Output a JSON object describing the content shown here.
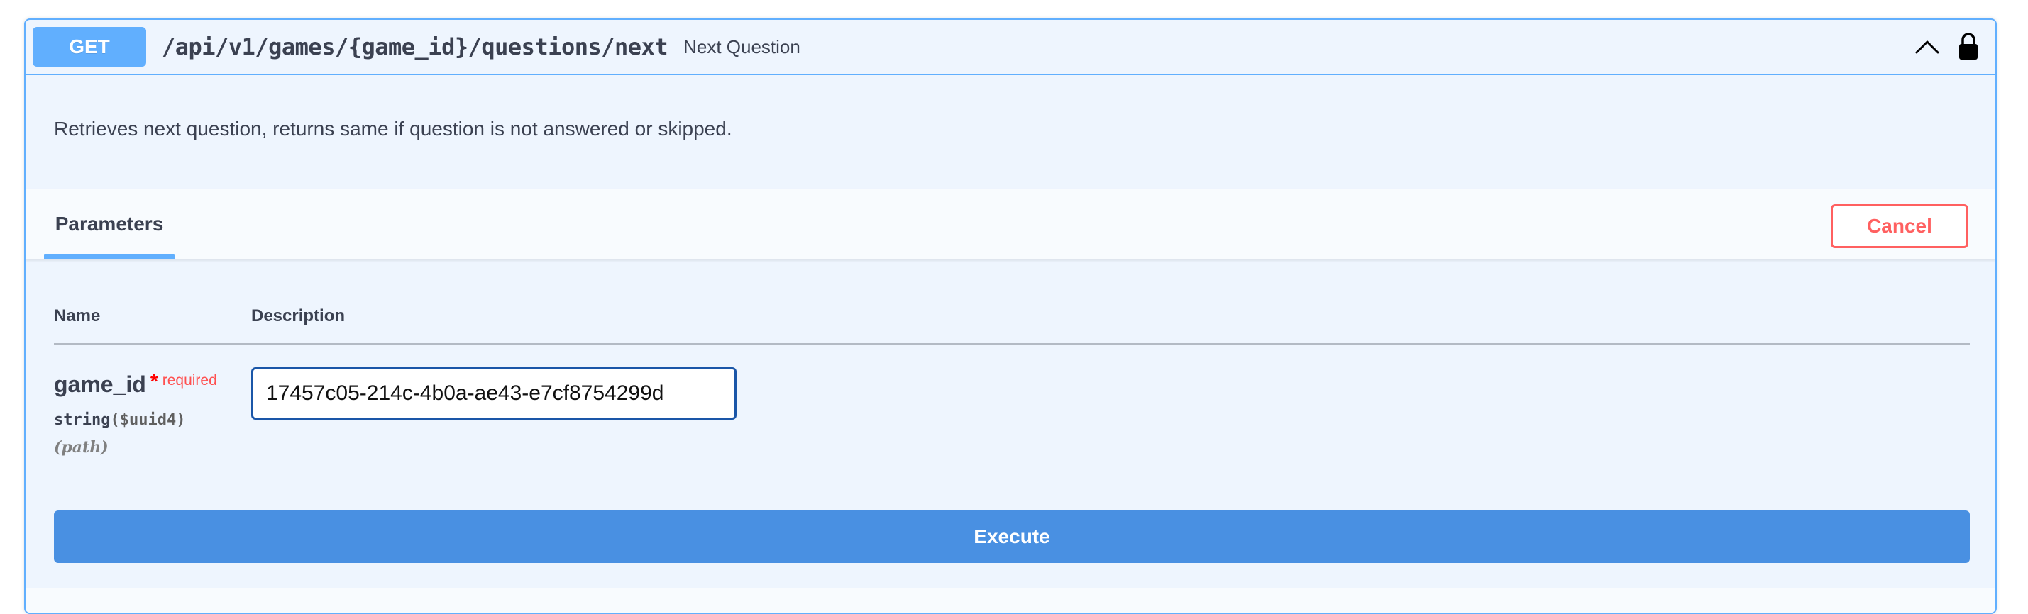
{
  "operation": {
    "method": "GET",
    "path": "/api/v1/games/{game_id}/questions/next",
    "summary": "Next Question",
    "description": "Retrieves next question, returns same if question is not answered or skipped."
  },
  "icons": {
    "collapse": "chevron-up-icon",
    "auth": "lock-icon"
  },
  "tabs": {
    "parameters_label": "Parameters",
    "cancel_label": "Cancel"
  },
  "table": {
    "columns": [
      "Name",
      "Description"
    ]
  },
  "parameter": {
    "name": "game_id",
    "required_marker": "*",
    "required_label": "required",
    "type": "string",
    "format": "($uuid4)",
    "location": "(path)",
    "value": "17457c05-214c-4b0a-ae43-e7cf8754299d"
  },
  "actions": {
    "execute_label": "Execute"
  },
  "colors": {
    "get_accent": "#61affe",
    "block_background": "#eef5fe",
    "cancel_red": "#ff6060",
    "execute_blue": "#4990e2"
  }
}
